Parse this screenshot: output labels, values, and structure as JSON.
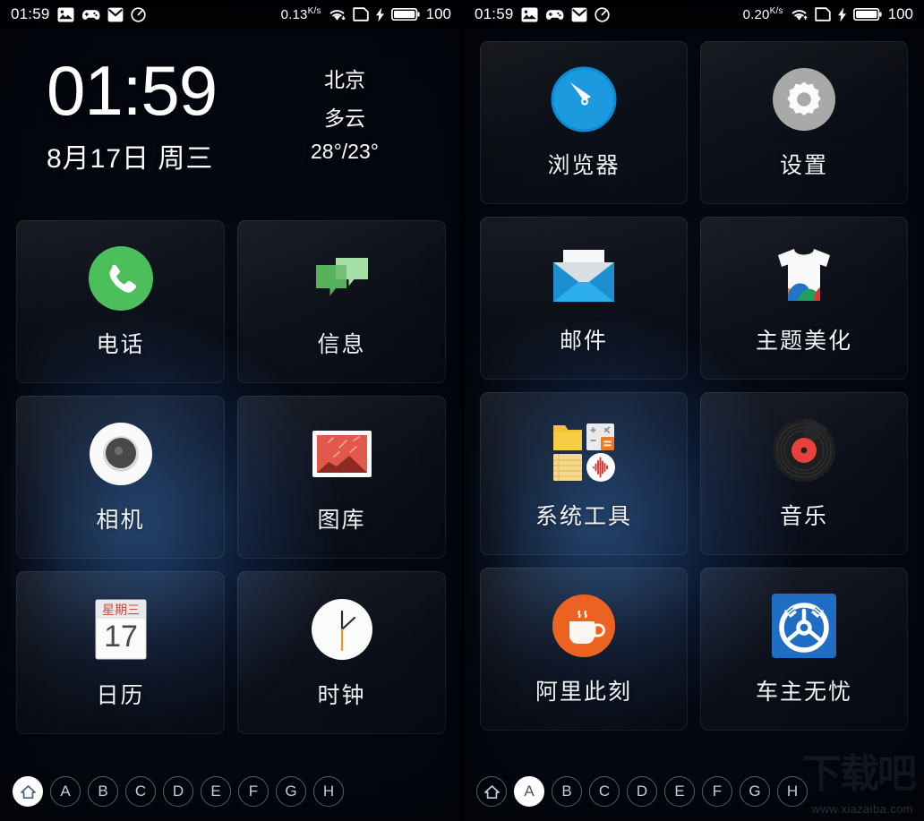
{
  "screens": [
    {
      "id": "home-screen",
      "status_bar": {
        "time": "01:59",
        "left_icons": [
          "image-icon",
          "gamepad-icon",
          "mail-icon",
          "clock-icon"
        ],
        "net_rate": "0.13",
        "net_rate_unit_top": "K",
        "net_rate_unit_bottom": "s",
        "right_icons": [
          "wifi-icon",
          "sdcard-icon",
          "charging-bolt-icon",
          "battery-icon"
        ],
        "battery_level": "100"
      },
      "clock_widget": {
        "time": "01:59",
        "date": "8月17日 周三",
        "city": "北京",
        "condition": "多云",
        "temperature": "28°/23°"
      },
      "apps": [
        {
          "label": "电话",
          "icon": "phone-icon"
        },
        {
          "label": "信息",
          "icon": "message-icon"
        },
        {
          "label": "相机",
          "icon": "camera-icon"
        },
        {
          "label": "图库",
          "icon": "gallery-icon"
        },
        {
          "label": "日历",
          "icon": "calendar-icon",
          "calendar_weekday": "星期三",
          "calendar_day": "17"
        },
        {
          "label": "时钟",
          "icon": "clock-face-icon"
        }
      ],
      "nav": {
        "items": [
          {
            "label": "",
            "icon": "home-icon",
            "active": true
          },
          {
            "label": "A",
            "active": false
          },
          {
            "label": "B",
            "active": false
          },
          {
            "label": "C",
            "active": false
          },
          {
            "label": "D",
            "active": false
          },
          {
            "label": "E",
            "active": false
          },
          {
            "label": "F",
            "active": false
          },
          {
            "label": "G",
            "active": false
          },
          {
            "label": "H",
            "active": false
          }
        ]
      }
    },
    {
      "id": "apps-screen-a",
      "status_bar": {
        "time": "01:59",
        "left_icons": [
          "image-icon",
          "gamepad-icon",
          "mail-icon",
          "clock-icon"
        ],
        "net_rate": "0.20",
        "net_rate_unit_top": "K",
        "net_rate_unit_bottom": "s",
        "right_icons": [
          "wifi-icon",
          "sdcard-icon",
          "charging-bolt-icon",
          "battery-icon"
        ],
        "battery_level": "100"
      },
      "apps": [
        {
          "label": "浏览器",
          "icon": "browser-compass-icon"
        },
        {
          "label": "设置",
          "icon": "gear-icon"
        },
        {
          "label": "邮件",
          "icon": "envelope-icon"
        },
        {
          "label": "主题美化",
          "icon": "tshirt-theme-icon"
        },
        {
          "label": "系统工具",
          "icon": "system-tools-folder-icon"
        },
        {
          "label": "音乐",
          "icon": "vinyl-record-icon"
        },
        {
          "label": "阿里此刻",
          "icon": "coffee-cup-icon"
        },
        {
          "label": "车主无忧",
          "icon": "steering-wheel-icon"
        }
      ],
      "nav": {
        "items": [
          {
            "label": "",
            "icon": "home-icon",
            "active": false
          },
          {
            "label": "A",
            "active": true
          },
          {
            "label": "B",
            "active": false
          },
          {
            "label": "C",
            "active": false
          },
          {
            "label": "D",
            "active": false
          },
          {
            "label": "E",
            "active": false
          },
          {
            "label": "F",
            "active": false
          },
          {
            "label": "G",
            "active": false
          },
          {
            "label": "H",
            "active": false
          }
        ]
      }
    }
  ],
  "watermark": {
    "brand": "下载吧",
    "url": "www.xiazaiba.com"
  },
  "colors": {
    "wallpaper_deep": "#030610",
    "wallpaper_blue": "#2a5fa8",
    "phone_green": "#4cbf5b",
    "message_green": "#5cb85c",
    "browser_blue": "#1b9ae0",
    "gear_gray": "#a8a8a8",
    "mail_blue": "#29a9e8",
    "music_red": "#e8403a",
    "coffee_orange": "#ec6220",
    "car_blue": "#1f6ec4",
    "gallery_red": "#e2584a",
    "calendar_red": "#d0493f",
    "clock_amber": "#e8971a",
    "tools_yellow": "#f2c230",
    "nav_active": "#ffffff"
  }
}
